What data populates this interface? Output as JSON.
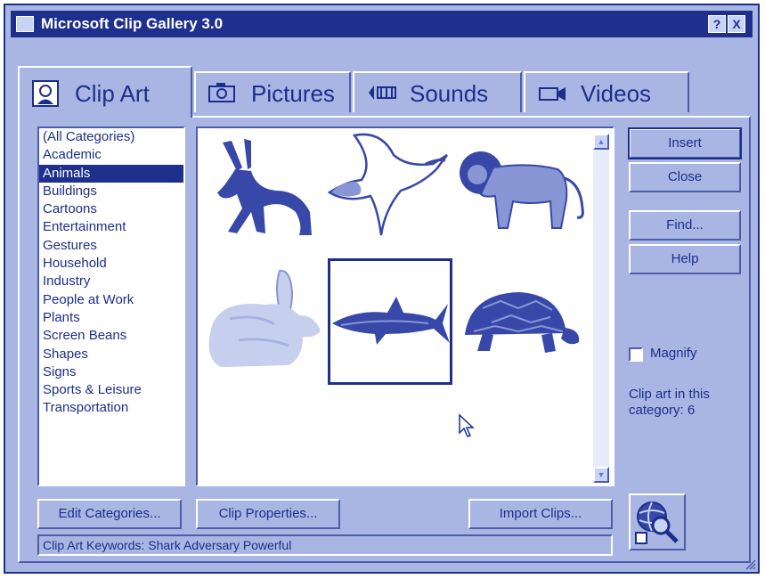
{
  "window": {
    "title": "Microsoft Clip Gallery 3.0",
    "help_glyph": "?",
    "close_glyph": "X"
  },
  "tabs": [
    {
      "label": "Clip Art",
      "icon": "clip-art-icon",
      "active": true
    },
    {
      "label": "Pictures",
      "icon": "camera-icon",
      "active": false
    },
    {
      "label": "Sounds",
      "icon": "sounds-icon",
      "active": false
    },
    {
      "label": "Videos",
      "icon": "video-camera-icon",
      "active": false
    }
  ],
  "categories": [
    "(All Categories)",
    "Academic",
    "Animals",
    "Buildings",
    "Cartoons",
    "Entertainment",
    "Gestures",
    "Household",
    "Industry",
    "People at Work",
    "Plants",
    "Screen Beans",
    "Shapes",
    "Signs",
    "Sports & Leisure",
    "Transportation"
  ],
  "selected_category": "Animals",
  "clips": [
    "donkey",
    "dove",
    "lion",
    "rabbit",
    "shark",
    "turtle"
  ],
  "selected_clip": "shark",
  "buttons": {
    "insert": "Insert",
    "close": "Close",
    "find": "Find...",
    "help": "Help",
    "edit_categories": "Edit Categories...",
    "clip_properties": "Clip Properties...",
    "import_clips": "Import Clips..."
  },
  "magnify": {
    "label": "Magnify",
    "checked": false
  },
  "info": {
    "line1": "Clip art in this",
    "line2": "category: 6"
  },
  "status_bar": "Clip Art Keywords:  Shark Adversary Powerful",
  "colors": {
    "accent": "#1f2f8e",
    "face": "#a9b6e3",
    "text": "#1b2f8a",
    "clip_fill": "#3848a8"
  }
}
